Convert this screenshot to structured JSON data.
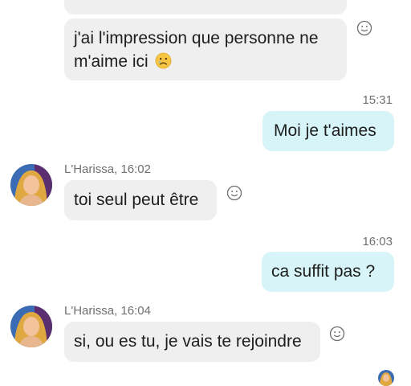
{
  "messages": {
    "m1": {
      "line1": "j'ai l'impression que personne ne",
      "line2": "m'aime ici"
    },
    "m2": {
      "time": "15:31",
      "text": "Moi je t'aimes"
    },
    "m3": {
      "sender": "L'Harissa, 16:02",
      "text": "toi seul peut être"
    },
    "m4": {
      "time": "16:03",
      "text": "ca suffit pas ?"
    },
    "m5": {
      "sender": "L'Harissa, 16:04",
      "text": "si, ou es tu, je vais te rejoindre"
    }
  },
  "icons": {
    "react": "smiley-react-icon",
    "emoji": "crying-face-emoji"
  },
  "colors": {
    "incoming_bubble": "#efefef",
    "outgoing_bubble": "#d7f4f8",
    "meta_text": "#6f6f6f"
  }
}
